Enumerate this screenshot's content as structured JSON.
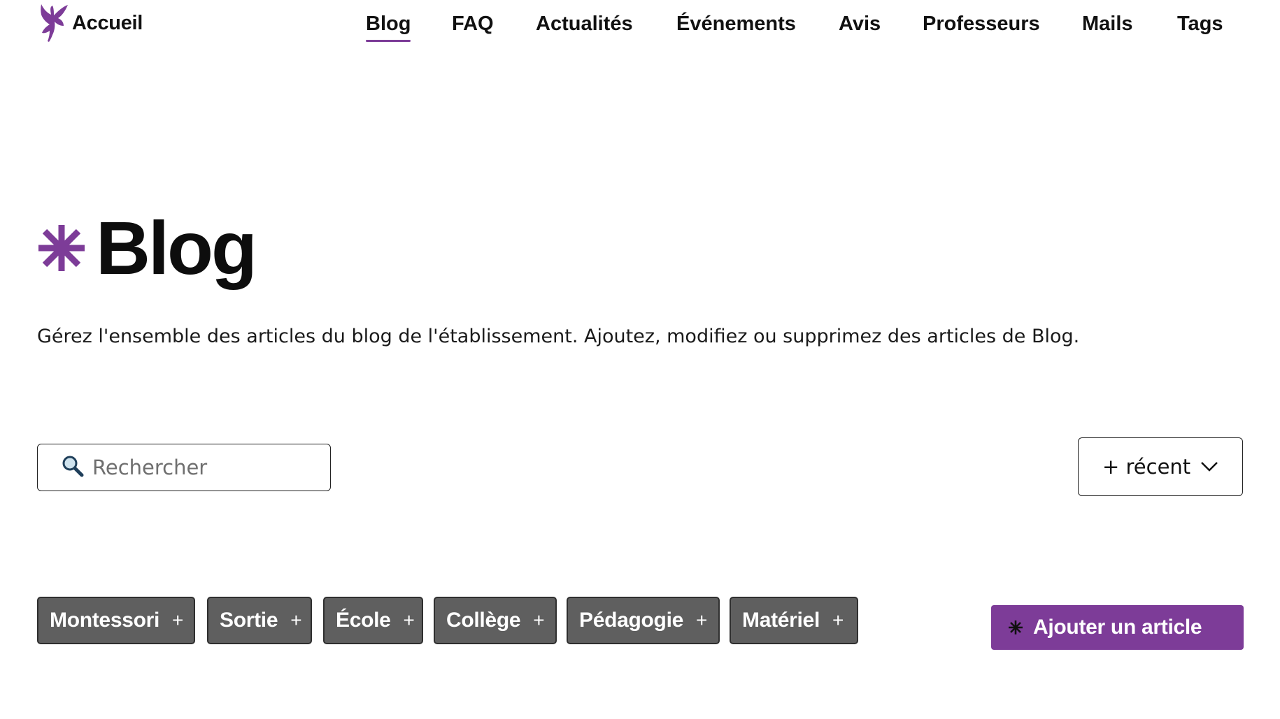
{
  "brand": {
    "label": "Accueil",
    "logo_icon": "butterfly-fairy-icon",
    "accent": "#7d3c98"
  },
  "nav": {
    "items": [
      {
        "label": "Blog",
        "active": true
      },
      {
        "label": "FAQ",
        "active": false
      },
      {
        "label": "Actualités",
        "active": false
      },
      {
        "label": "Événements",
        "active": false
      },
      {
        "label": "Avis",
        "active": false
      },
      {
        "label": "Professeurs",
        "active": false
      },
      {
        "label": "Mails",
        "active": false
      },
      {
        "label": "Tags",
        "active": false
      }
    ]
  },
  "page": {
    "title": "Blog",
    "title_icon": "asterisk-icon",
    "description": "Gérez l'ensemble des articles du blog de l'établissement. Ajoutez, modifiez ou supprimez des articles de Blog."
  },
  "search": {
    "placeholder": "Rechercher",
    "value": "",
    "icon": "search-icon"
  },
  "sort": {
    "selected": "+ récent",
    "icon": "chevron-down-icon"
  },
  "tags": [
    {
      "label": "Montessori",
      "action": "+"
    },
    {
      "label": "Sortie",
      "action": "+"
    },
    {
      "label": "École",
      "action": "+"
    },
    {
      "label": "Collège",
      "action": "+"
    },
    {
      "label": "Pédagogie",
      "action": "+"
    },
    {
      "label": "Matériel",
      "action": "+"
    }
  ],
  "add_button": {
    "label": "Ajouter un article",
    "icon": "asterisk-icon"
  },
  "colors": {
    "accent": "#7d3c98",
    "tag_bg": "#5f5f5f",
    "text": "#111111"
  }
}
